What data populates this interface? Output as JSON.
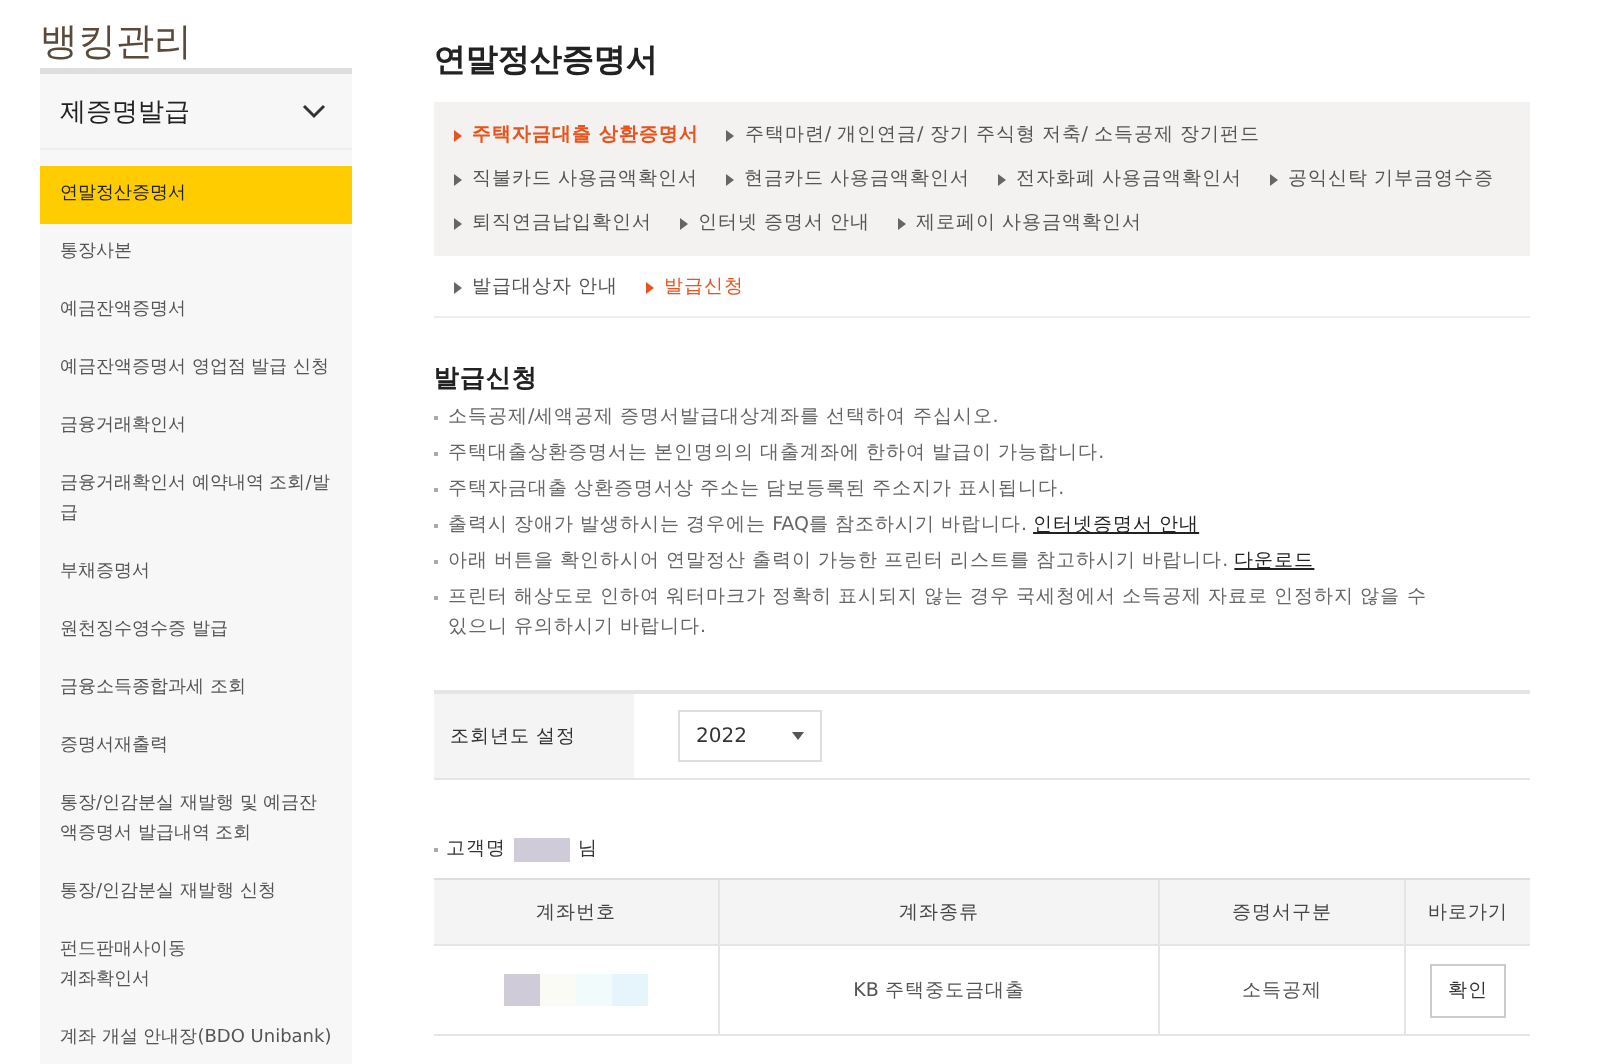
{
  "app_title": "뱅킹관리",
  "sidebar": {
    "header": "제증명발급",
    "expanded": true,
    "items": [
      {
        "label": "연말정산증명서",
        "selected": true
      },
      {
        "label": "통장사본",
        "selected": false
      },
      {
        "label": "예금잔액증명서",
        "selected": false
      },
      {
        "label": "예금잔액증명서 영업점 발급 신청",
        "selected": false
      },
      {
        "label": "금융거래확인서",
        "selected": false
      },
      {
        "label": "금융거래확인서 예약내역 조회/발급",
        "selected": false
      },
      {
        "label": "부채증명서",
        "selected": false
      },
      {
        "label": "원천징수영수증 발급",
        "selected": false
      },
      {
        "label": "금융소득종합과세 조회",
        "selected": false
      },
      {
        "label": "증명서재출력",
        "selected": false
      },
      {
        "label": "통장/인감분실 재발행 및 예금잔액증명서 발급내역 조회",
        "selected": false
      },
      {
        "label": "통장/인감분실 재발행 신청",
        "selected": false
      },
      {
        "label": "펀드판매사이동\n계좌확인서",
        "selected": false
      },
      {
        "label": "계좌 개설 안내장(BDO Unibank)",
        "selected": false
      }
    ]
  },
  "page_title": "연말정산증명서",
  "cert_tabs": [
    {
      "label": "주택자금대출 상환증명서",
      "selected": true
    },
    {
      "label": "주택마련/ 개인연금/ 장기 주식형 저축/ 소득공제 장기펀드",
      "selected": false
    },
    {
      "label": "직불카드 사용금액확인서",
      "selected": false
    },
    {
      "label": "현금카드 사용금액확인서",
      "selected": false
    },
    {
      "label": "전자화폐 사용금액확인서",
      "selected": false
    },
    {
      "label": "공익신탁 기부금영수증",
      "selected": false
    },
    {
      "label": "퇴직연금납입확인서",
      "selected": false
    },
    {
      "label": "인터넷 증명서 안내",
      "selected": false
    },
    {
      "label": "제로페이 사용금액확인서",
      "selected": false
    }
  ],
  "sub_tabs": [
    {
      "label": "발급대상자 안내",
      "selected": false
    },
    {
      "label": "발급신청",
      "selected": true
    }
  ],
  "section": {
    "heading": "발급신청",
    "notes": [
      {
        "text": "소득공제/세액공제 증명서발급대상계좌를 선택하여 주십시오."
      },
      {
        "text": "주택대출상환증명서는 본인명의의 대출계좌에 한하여 발급이 가능합니다."
      },
      {
        "text": "주택자금대출 상환증명서상 주소는 담보등록된 주소지가 표시됩니다."
      },
      {
        "text": "출력시 장애가 발생하시는 경우에는 FAQ를 참조하시기 바랍니다.",
        "link": "인터넷증명서 안내"
      },
      {
        "text": "아래 버튼을 확인하시어 연말정산 출력이 가능한 프린터 리스트를 참고하시기 바랍니다.",
        "link": "다운로드"
      },
      {
        "text": "프린터 해상도로 인하여 워터마크가 정확히 표시되지 않는 경우 국세청에서 소득공제 자료로 인정하지 않을 수 있으니 유의하시기 바랍니다."
      }
    ]
  },
  "year_filter": {
    "label": "조회년도 설정",
    "value": "2022"
  },
  "customer": {
    "label": "고객명",
    "suffix": "님"
  },
  "table": {
    "columns": [
      "계좌번호",
      "계좌종류",
      "증명서구분",
      "바로가기"
    ],
    "rows": [
      {
        "account_type": "KB 주택중도금대출",
        "certificate_type": "소득공제",
        "action": "확인"
      }
    ]
  }
}
